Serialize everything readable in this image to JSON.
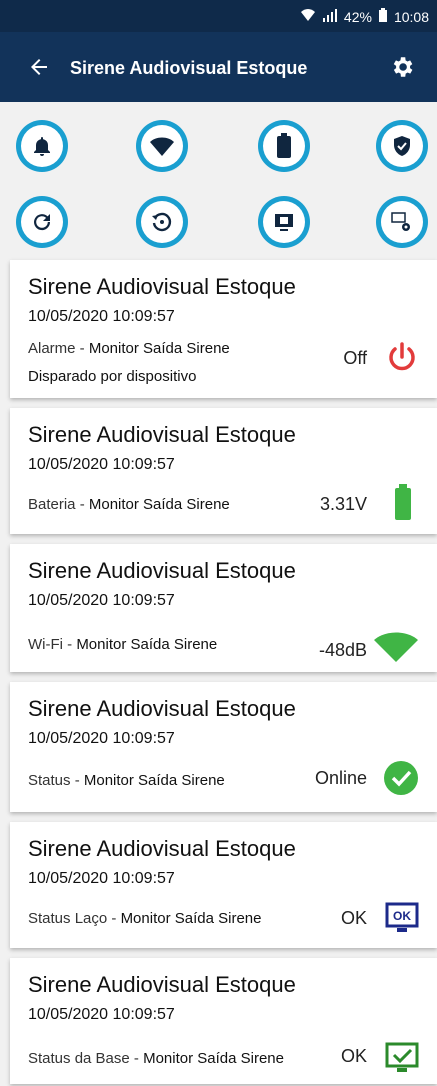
{
  "status_bar": {
    "battery": "42%",
    "time": "10:08"
  },
  "app_bar": {
    "title": "Sirene Audiovisual Estoque"
  },
  "cards": [
    {
      "title": "Sirene Audiovisual Estoque",
      "datetime": "10/05/2020  10:09:57",
      "label": "Alarme - ",
      "source": "Monitor Saída Sirene",
      "extra": "Disparado por dispositivo",
      "value": "Off",
      "icon": "power-icon",
      "color": "#e23b3b"
    },
    {
      "title": "Sirene Audiovisual Estoque",
      "datetime": "10/05/2020  10:09:57",
      "label": "Bateria - ",
      "source": "Monitor Saída Sirene",
      "value": "3.31V",
      "icon": "battery-icon",
      "color": "#40b545"
    },
    {
      "title": "Sirene Audiovisual Estoque",
      "datetime": "10/05/2020  10:09:57",
      "label": "Wi-Fi - ",
      "source": "Monitor Saída Sirene",
      "value": "-48dB",
      "icon": "wifi-icon",
      "color": "#40b545"
    },
    {
      "title": "Sirene Audiovisual Estoque",
      "datetime": "10/05/2020  10:09:57",
      "label": "Status - ",
      "source": "Monitor Saída Sirene",
      "value": "Online",
      "icon": "check-circle-icon",
      "color": "#40b545"
    },
    {
      "title": "Sirene Audiovisual Estoque",
      "datetime": "10/05/2020  10:09:57",
      "label": "Status Laço - ",
      "source": "Monitor Saída Sirene",
      "value": "OK",
      "icon": "ok-monitor-icon",
      "color": "#1c2a8a"
    },
    {
      "title": "Sirene Audiovisual Estoque",
      "datetime": "10/05/2020  10:09:57",
      "label": "Status da Base - ",
      "source": "Monitor Saída Sirene",
      "value": "OK",
      "icon": "check-box-monitor-icon",
      "color": "#2b8a2b"
    }
  ],
  "icons": {
    "top_row": [
      "bell-icon",
      "wifi-icon",
      "battery-icon",
      "shield-check-icon"
    ],
    "bottom_row": [
      "refresh-icon",
      "history-icon",
      "monitor-icon",
      "monitor-settings-icon"
    ]
  }
}
